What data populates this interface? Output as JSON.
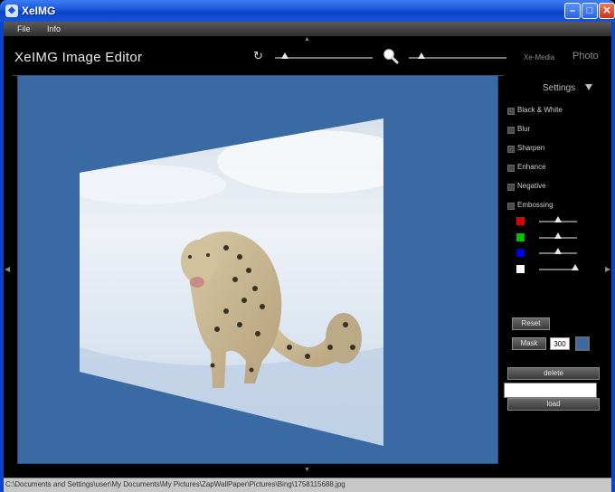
{
  "window": {
    "title": "XeIMG"
  },
  "menu": [
    {
      "label": "File"
    },
    {
      "label": "Info"
    }
  ],
  "app": {
    "title": "XeIMG Image Editor",
    "xe_media": "Xe-Media",
    "photo": "Photo"
  },
  "toolbar": {
    "rotate_level": 0.1,
    "zoom_level": 0.13
  },
  "settings": {
    "title": "Settings",
    "options": [
      {
        "label": "Black & White"
      },
      {
        "label": "Blur"
      },
      {
        "label": "Sharpen"
      },
      {
        "label": "Enhance"
      },
      {
        "label": "Negative"
      },
      {
        "label": "Embossing"
      }
    ],
    "channels": [
      {
        "color": "#e00000",
        "level": 0.5
      },
      {
        "color": "#00c000",
        "level": 0.5
      },
      {
        "color": "#0000e0",
        "level": 0.5
      },
      {
        "color": "#ffffff",
        "level": 0.95
      }
    ],
    "reset_label": "Reset",
    "mask_label": "Mask",
    "mask_value": "300",
    "mask_color": "#3a6aa3",
    "delete_label": "delete",
    "load_label": "load"
  },
  "status": {
    "path": "C:\\Documents and Settings\\user\\My Documents\\My Pictures\\ZapWallPaper\\Pictures\\Bing\\1758115688.jpg"
  }
}
